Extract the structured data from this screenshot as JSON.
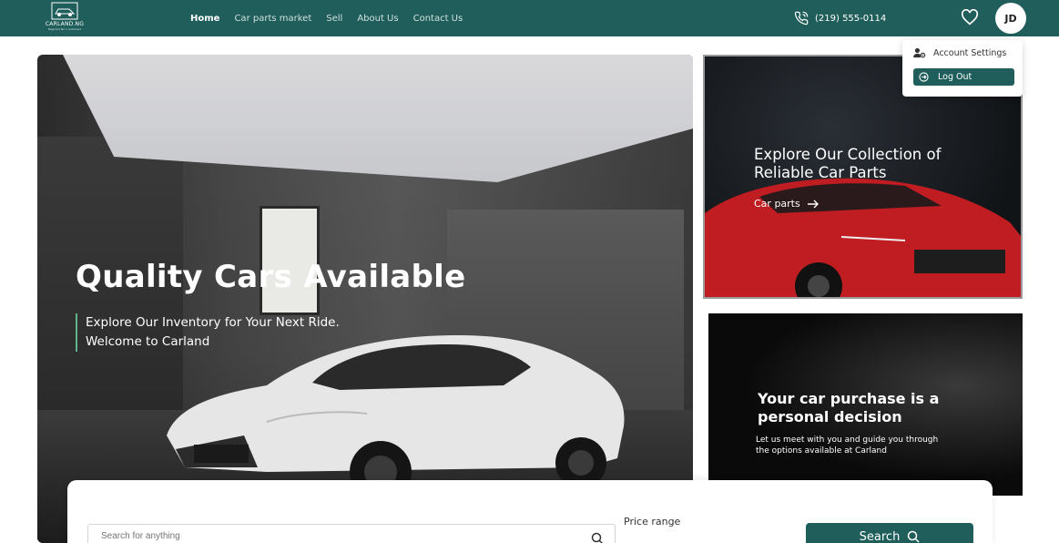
{
  "header": {
    "logo_brand": "CARLAND.NG",
    "logo_tagline": "Nigeria's No 1 Automart",
    "nav": [
      {
        "label": "Home",
        "active": true
      },
      {
        "label": "Car parts market",
        "active": false
      },
      {
        "label": "Sell",
        "active": false
      },
      {
        "label": "About Us",
        "active": false
      },
      {
        "label": "Contact Us",
        "active": false
      }
    ],
    "phone": "(219) 555-0114",
    "avatar_initials": "JD",
    "icons": {
      "phone": "phone-icon",
      "wishlist": "heart-icon"
    }
  },
  "account_menu": {
    "settings_label": "Account Settings",
    "logout_label": "Log Out",
    "icons": {
      "settings": "user-gear-icon",
      "logout": "logout-icon"
    }
  },
  "hero": {
    "title": "Quality Cars Available",
    "subtitle_line1": "Explore Our Inventory for Your Next Ride.",
    "subtitle_line2": "Welcome to Carland"
  },
  "card_parts": {
    "title_line1": "Explore Our Collection of",
    "title_line2": "Reliable Car Parts",
    "link_label": "Car parts",
    "icon": "arrow-right-icon"
  },
  "card_purchase": {
    "title_line1": "Your car purchase is a",
    "title_line2": "personal decision",
    "desc_line1": "Let us meet with you and guide you through",
    "desc_line2": "the options available at Carland"
  },
  "search_panel": {
    "placeholder": "Search for anything",
    "price_label": "Price range",
    "button_label": "Search",
    "icons": {
      "search": "search-icon"
    }
  },
  "colors": {
    "brand": "#1f5e5b",
    "accent_bar": "#5fb38a"
  }
}
